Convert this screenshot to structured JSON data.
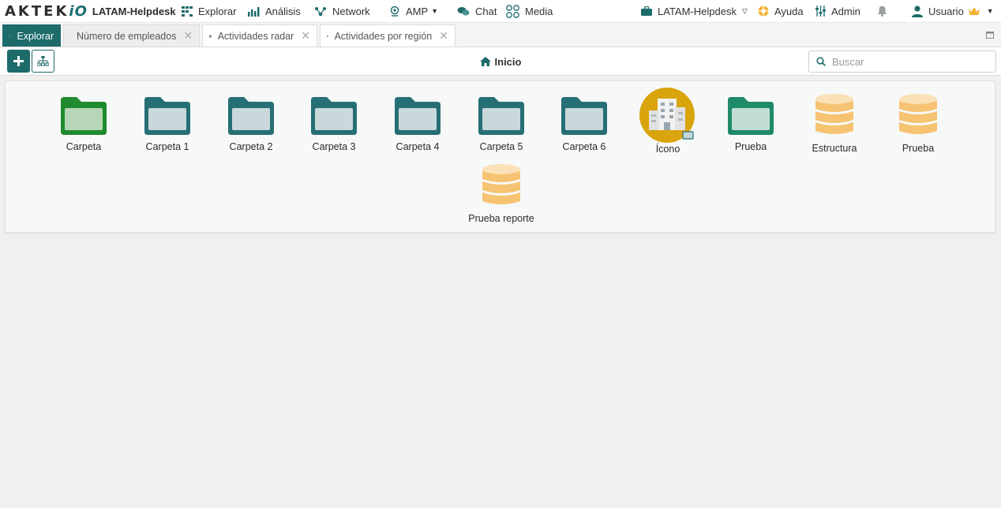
{
  "app": {
    "logo_text": "AKTEK",
    "logo_suffix": "iO",
    "workspace": "LATAM-Helpdesk"
  },
  "nav": {
    "explorar": "Explorar",
    "analisis": "Análisis",
    "network": "Network",
    "amp": "AMP",
    "chat": "Chat",
    "media": "Media",
    "workspace_selector": "LATAM-Helpdesk",
    "ayuda": "Ayuda",
    "admin": "Admin",
    "usuario": "Usuario"
  },
  "tabs": [
    {
      "label": "Explorar",
      "icon": "grid-icon",
      "active": true
    },
    {
      "label": "Número de empleados",
      "icon": "database-icon"
    },
    {
      "label": "Actividades radar",
      "icon": "database-icon"
    },
    {
      "label": "Actividades por región",
      "icon": "database-icon"
    }
  ],
  "toolbar": {
    "breadcrumb": "Inicio",
    "search_placeholder": "Buscar"
  },
  "items": [
    {
      "label": "Carpeta",
      "type": "folder-green"
    },
    {
      "label": "Carpeta 1",
      "type": "folder-teal"
    },
    {
      "label": "Carpeta 2",
      "type": "folder-teal"
    },
    {
      "label": "Carpeta 3",
      "type": "folder-teal"
    },
    {
      "label": "Carpeta 4",
      "type": "folder-teal"
    },
    {
      "label": "Carpeta 5",
      "type": "folder-teal"
    },
    {
      "label": "Carpeta 6",
      "type": "folder-teal"
    },
    {
      "label": "Ícono",
      "type": "building-icon"
    },
    {
      "label": "Prueba",
      "type": "folder-teal-green"
    },
    {
      "label": "Estructura",
      "type": "database"
    },
    {
      "label": "Prueba",
      "type": "database"
    },
    {
      "label": "Prueba reporte",
      "type": "database"
    }
  ],
  "colors": {
    "primary": "#1d6b6b",
    "folder_green": "#1f8a2e",
    "folder_teal": "#266f75",
    "database": "#f6c372",
    "icon_circle": "#d9a40c"
  }
}
